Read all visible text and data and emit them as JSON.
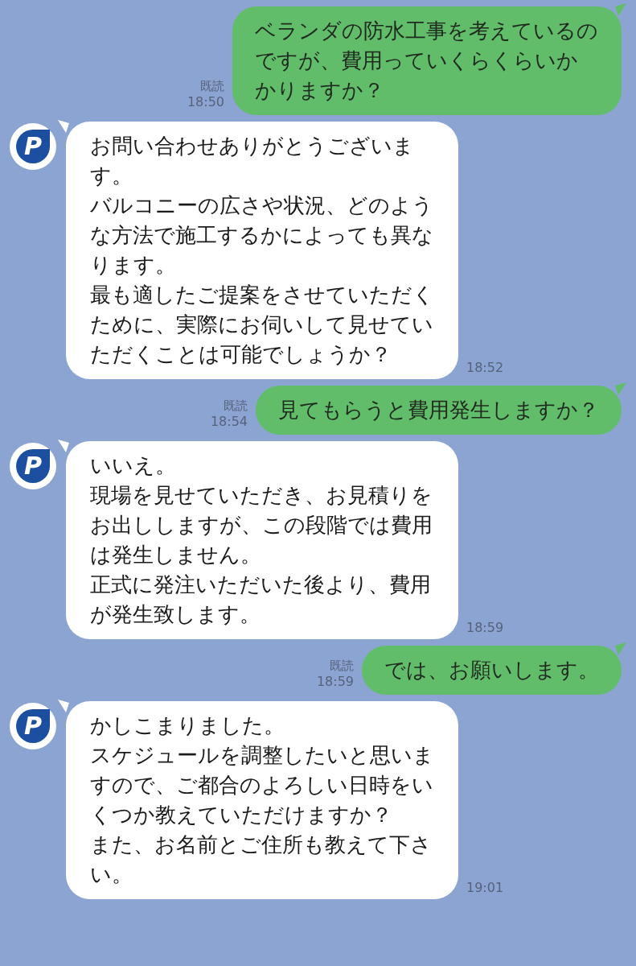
{
  "messages": [
    {
      "kind": "sent",
      "paragraphs": [
        "ベランダの防水工事を考えているのですが、費用っていくらくらいかかりますか？"
      ],
      "read": "既読",
      "time": "18:50"
    },
    {
      "kind": "received",
      "avatar": "P",
      "paragraphs": [
        "お問い合わせありがとうございます。",
        "バルコニーの広さや状況、どのような方法で施工するかによっても異なります。",
        "最も適したご提案をさせていただくために、実際にお伺いして見せていただくことは可能でしょうか？"
      ],
      "time": "18:52"
    },
    {
      "kind": "sent",
      "paragraphs": [
        "見てもらうと費用発生しますか？"
      ],
      "read": "既読",
      "time": "18:54"
    },
    {
      "kind": "received",
      "avatar": "P",
      "paragraphs": [
        "いいえ。",
        "現場を見せていただき、お見積りをお出ししますが、この段階では費用は発生しません。",
        "正式に発注いただいた後より、費用が発生致します。"
      ],
      "time": "18:59"
    },
    {
      "kind": "sent",
      "paragraphs": [
        "では、お願いします。"
      ],
      "read": "既読",
      "time": "18:59"
    },
    {
      "kind": "received",
      "avatar": "P",
      "paragraphs": [
        "かしこまりました。",
        "スケジュールを調整したいと思いますので、ご都合のよろしい日時をいくつか教えていただけますか？",
        "また、お名前とご住所も教えて下さい。"
      ],
      "time": "19:01"
    }
  ]
}
